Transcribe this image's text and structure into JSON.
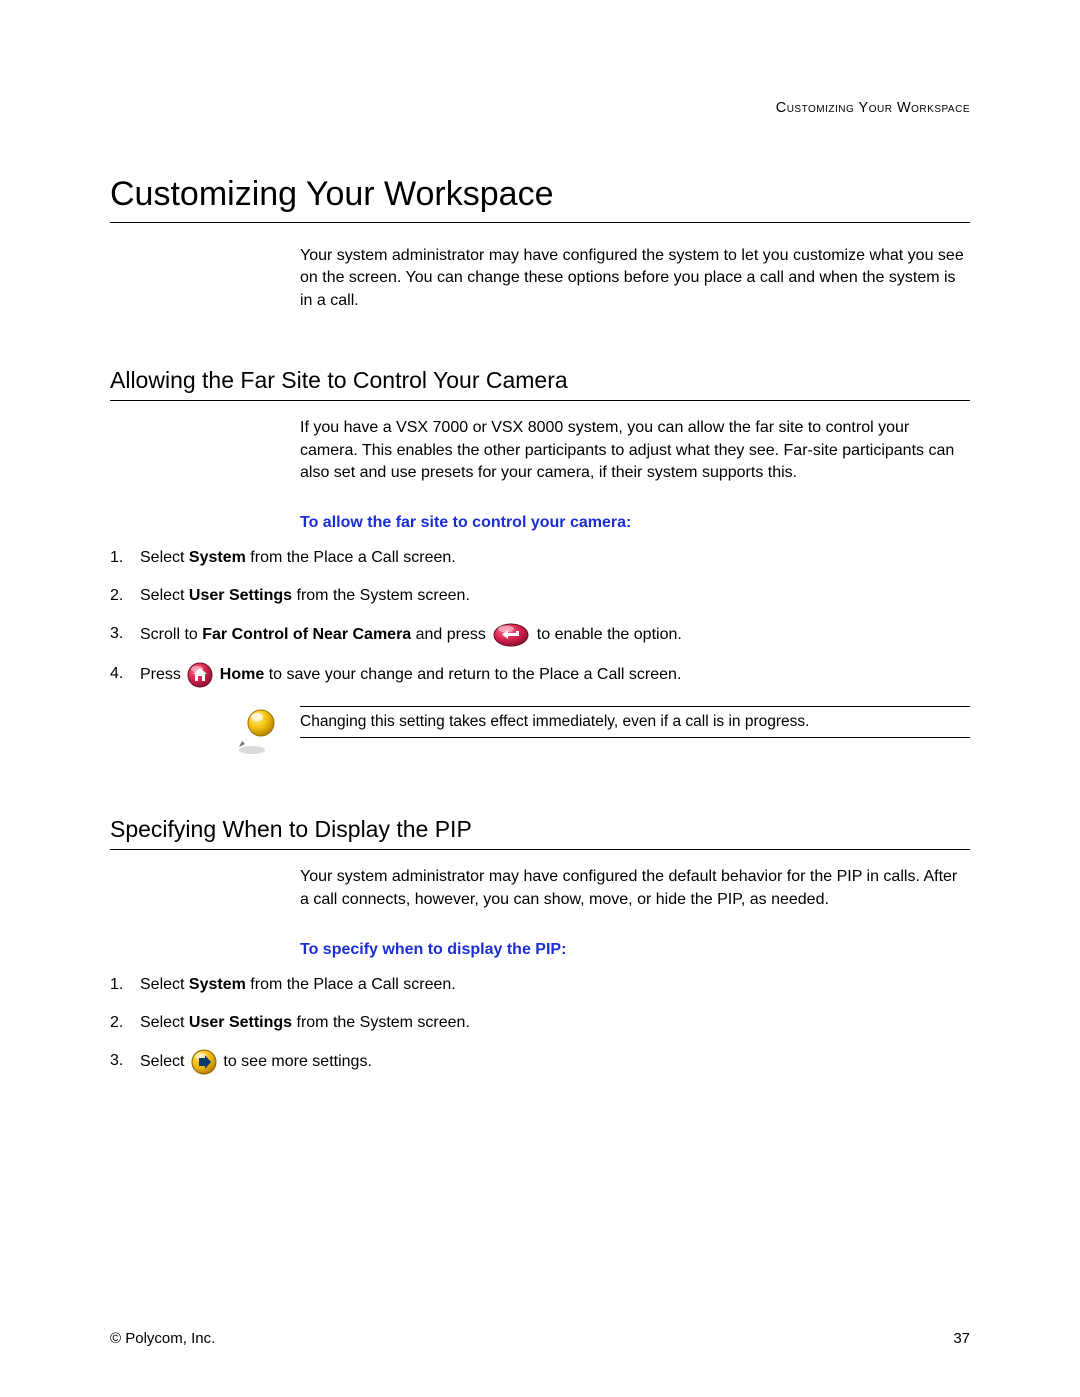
{
  "running_head": "Customizing Your Workspace",
  "page_title": "Customizing Your Workspace",
  "intro": "Your system administrator may have configured the system to let you customize what you see on the screen. You can change these options before you place a call and when the system is in a call.",
  "sectionA": {
    "heading": "Allowing the Far Site to Control Your Camera",
    "para": "If you have a VSX 7000 or VSX 8000 system, you can allow the far site to control your camera. This enables the other participants to adjust what they see. Far-site participants can also set and use presets for your camera, if their system supports this.",
    "task_head": "To allow the far site to control your camera:",
    "steps": {
      "s1_a": "Select ",
      "s1_b": "System",
      "s1_c": " from the Place a Call screen.",
      "s2_a": "Select ",
      "s2_b": "User Settings",
      "s2_c": " from the System screen.",
      "s3_a": "Scroll to ",
      "s3_b": "Far Control of Near Camera",
      "s3_c": " and press ",
      "s3_d": " to enable the option.",
      "s4_a": "Press ",
      "s4_b": "Home",
      "s4_c": " to save your change and return to the Place a Call screen."
    },
    "note": "Changing this setting takes effect immediately, even if a call is in progress."
  },
  "sectionB": {
    "heading": "Specifying When to Display the PIP",
    "para": "Your system administrator may have configured the default behavior for the PIP in calls. After a call connects, however, you can show, move, or hide the PIP, as needed.",
    "task_head": "To specify when to display the PIP:",
    "steps": {
      "s1_a": "Select ",
      "s1_b": "System",
      "s1_c": " from the Place a Call screen.",
      "s2_a": "Select ",
      "s2_b": "User Settings",
      "s2_c": " from the System screen.",
      "s3_a": "Select ",
      "s3_b": " to see more settings."
    }
  },
  "footer": {
    "left": "© Polycom, Inc.",
    "right": "37"
  },
  "nums": {
    "n1": "1.",
    "n2": "2.",
    "n3": "3.",
    "n4": "4."
  }
}
